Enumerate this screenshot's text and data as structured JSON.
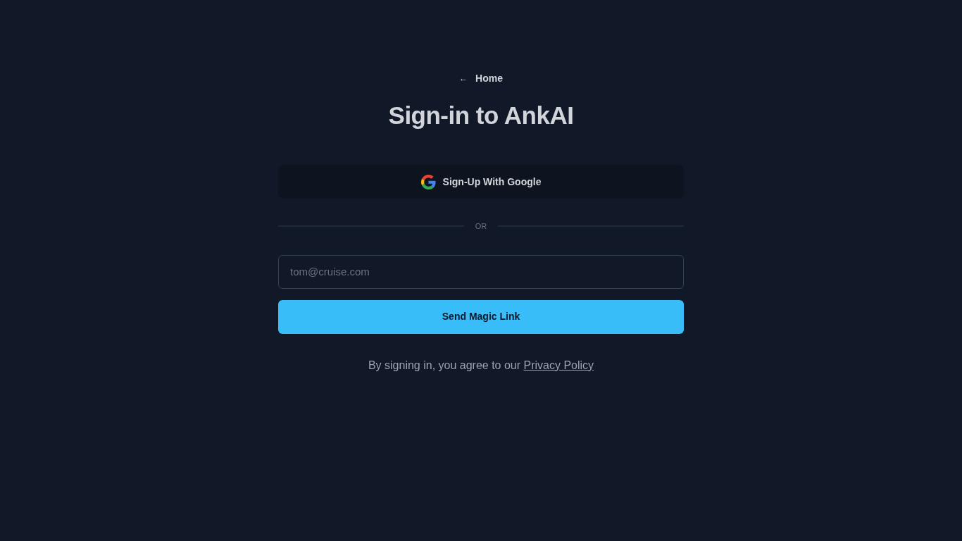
{
  "back_link": {
    "icon": "←",
    "label": "Home"
  },
  "title": "Sign-in to AnkAI",
  "google_button": {
    "label": "Sign-Up With Google"
  },
  "divider": {
    "label": "OR"
  },
  "email_field": {
    "placeholder": "tom@cruise.com"
  },
  "submit_button": {
    "label": "Send Magic Link"
  },
  "footer": {
    "text": "By signing in, you agree to our",
    "link": "Privacy Policy"
  }
}
